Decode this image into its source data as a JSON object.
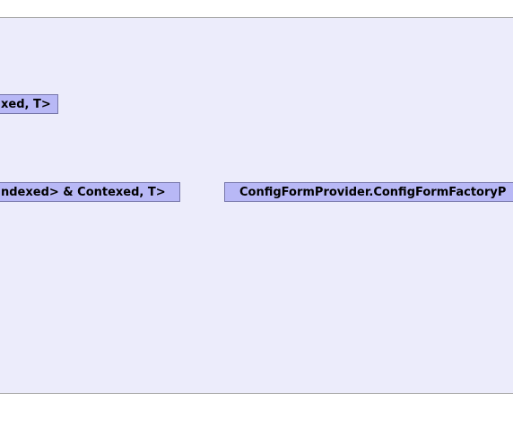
{
  "colors": {
    "panel_fill": "#ececfb",
    "node_fill": "#b8b8f6",
    "node_border": "#7777aa",
    "divider": "#222222"
  },
  "nodes": {
    "top_left": "xed, T>",
    "bottom_left": "ndexed> & Contexed, T>",
    "bottom_right": "ConfigFormProvider.ConfigFormFactoryP"
  }
}
